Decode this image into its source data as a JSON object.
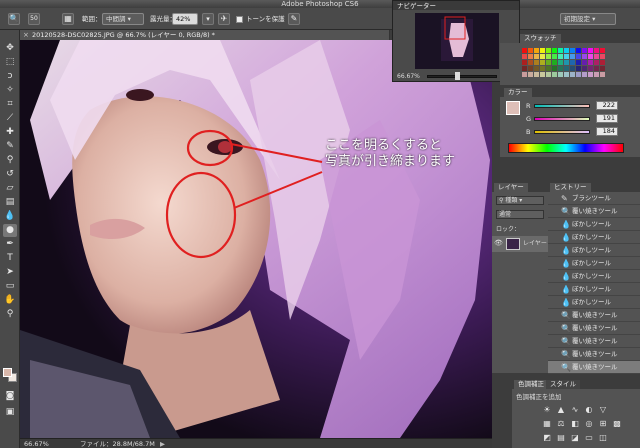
{
  "app": {
    "title": "Adobe Photoshop CS6"
  },
  "options": {
    "size_value": "50",
    "range_label": "範囲：",
    "range_value": "中間調",
    "exposure_label": "露光量：",
    "exposure_value": "42%",
    "protect_tone_label": "トーンを保護",
    "preset_value": "初期設定"
  },
  "document": {
    "tab_title": "20120528-DSC02825.JPG @ 66.7% (レイヤー 0, RGB/8) *",
    "annotation_line1": "ここを明るくすると",
    "annotation_line2": "写真が引き締まります"
  },
  "status": {
    "zoom": "66.67%",
    "file_info": "ファイル：28.8M/68.7M"
  },
  "navigator": {
    "tab": "ナビゲーター",
    "zoom": "66.67%"
  },
  "swatches": {
    "tab": "スウォッチ"
  },
  "color": {
    "tab": "カラー",
    "r_label": "R",
    "g_label": "G",
    "b_label": "B",
    "r": "222",
    "g": "191",
    "b": "184",
    "fg_color": "#debfb8"
  },
  "layers": {
    "tab": "レイヤー",
    "kind": "種類",
    "blend": "通常",
    "lock_label": "ロック：",
    "layer_name": "レイヤー 0"
  },
  "history": {
    "tab": "ヒストリー",
    "items": [
      {
        "label": "ブラシツール",
        "icon": "brush-icon"
      },
      {
        "label": "覆い焼きツール",
        "icon": "dodge-icon"
      },
      {
        "label": "ぼかしツール",
        "icon": "blur-icon"
      },
      {
        "label": "ぼかしツール",
        "icon": "blur-icon"
      },
      {
        "label": "ぼかしツール",
        "icon": "blur-icon"
      },
      {
        "label": "ぼかしツール",
        "icon": "blur-icon"
      },
      {
        "label": "ぼかしツール",
        "icon": "blur-icon"
      },
      {
        "label": "ぼかしツール",
        "icon": "blur-icon"
      },
      {
        "label": "ぼかしツール",
        "icon": "blur-icon"
      },
      {
        "label": "覆い焼きツール",
        "icon": "dodge-icon"
      },
      {
        "label": "覆い焼きツール",
        "icon": "dodge-icon"
      },
      {
        "label": "覆い焼きツール",
        "icon": "dodge-icon"
      },
      {
        "label": "覆い焼きツール",
        "icon": "dodge-icon"
      },
      {
        "label": "覆い焼きツール",
        "icon": "dodge-icon"
      }
    ]
  },
  "adjustments": {
    "tab1": "色調補正",
    "tab2": "スタイル",
    "add_label": "色調補正を追加"
  }
}
